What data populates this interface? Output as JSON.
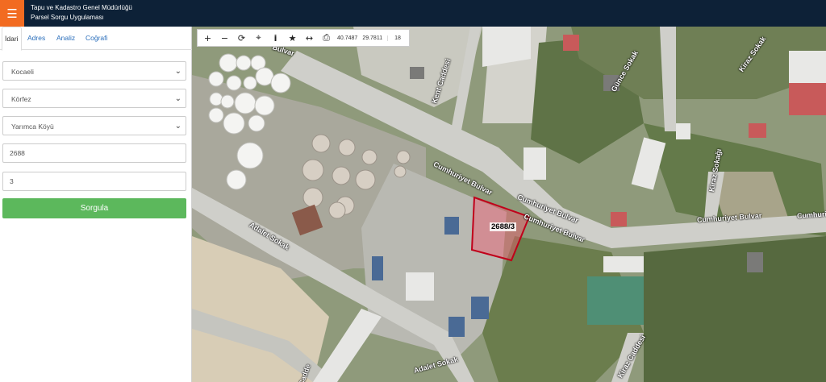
{
  "header": {
    "org_title": "Tapu ve Kadastro Genel Müdürlüğü",
    "app_title": "Parsel Sorgu Uygulaması",
    "menu_icon": "hamburger-icon"
  },
  "sidebar": {
    "tabs": [
      {
        "label": "İdari",
        "active": true
      },
      {
        "label": "Adres",
        "active": false
      },
      {
        "label": "Analiz",
        "active": false
      },
      {
        "label": "Coğrafi",
        "active": false
      }
    ],
    "province": "Kocaeli",
    "district": "Körfez",
    "neighborhood": "Yarımca Köyü",
    "block": "2688",
    "parcel": "3",
    "submit_label": "Sorgula"
  },
  "toolbar": {
    "lat": "40.7487",
    "lon": "29.7811",
    "zoom": "18"
  },
  "map": {
    "parcel_label": "2688/3",
    "roads": {
      "cumhuriyet_1": "Cumhuriyet Bulvar",
      "cumhuriyet_2": "Cumhuriyet Bulvar",
      "cumhuriyet_3": "Cumhuriyet Bulvar",
      "cumhuriyet_4": "Cumhuriyet Bulvar",
      "cumhuriyet_5": "Cumhuriyet Bulvar",
      "adalet_1": "Adalet Sokak",
      "adalet_2": "Adalet Sokak",
      "kent": "Kent Caddesi",
      "gunce": "Günce Sokak",
      "kiraz_1": "Kiraz Sokak",
      "kiraz_2": "Kiraz Sokağı",
      "kiraz_3": "Kiraz Caddesi",
      "bulvar_top": "Bulvar",
      "cadde_bottom": "Cadde"
    },
    "parcel_color": "#c0001a"
  }
}
